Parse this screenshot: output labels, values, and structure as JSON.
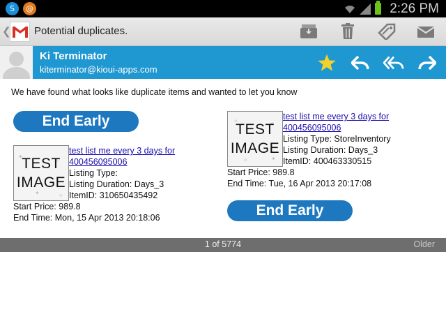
{
  "status_bar": {
    "time": "2:26 PM",
    "notification_icons": [
      "skype-icon",
      "app-notification-icon"
    ],
    "system_icons": [
      "wifi-icon",
      "signal-icon",
      "battery-icon"
    ],
    "battery_color": "#6ac21b"
  },
  "action_bar": {
    "title": "Potential duplicates.",
    "actions": [
      "archive-icon",
      "delete-icon",
      "label-icon",
      "mark-unread-icon"
    ]
  },
  "sender": {
    "name": "Ki Terminator",
    "email": "kiterminator@kioui-apps.com",
    "actions": [
      "star-icon",
      "reply-icon",
      "reply-all-icon",
      "forward-icon"
    ],
    "header_color": "#1f97d0",
    "star_color": "#f2d22a"
  },
  "message": {
    "intro": "We have found what looks like duplicate items and wanted to let you know",
    "button_label": "End Early",
    "button_color": "#1d78c0",
    "items": [
      {
        "thumb_line1": "TEST",
        "thumb_line2": "IMAGE",
        "title_line1": "test list me every 3 days for",
        "title_line2": "400456095006",
        "listing_type": "Listing Type:",
        "listing_duration": "Listing Duration: Days_3",
        "item_id": "ItemID: 310650435492",
        "start_price": "Start Price: 989.8",
        "end_time": "End Time: Mon, 15 Apr 2013 20:18:06"
      },
      {
        "thumb_line1": "TEST",
        "thumb_line2": "IMAGE",
        "title_line1": "test list me every 3 days for",
        "title_line2": "400456095006",
        "listing_type": "Listing Type: StoreInventory",
        "listing_duration": "Listing Duration: Days_3",
        "item_id": "ItemID: 400463330515",
        "start_price": "Start Price: 989.8",
        "end_time": "End Time: Tue, 16 Apr 2013 20:17:08"
      }
    ]
  },
  "pager": {
    "count": "1 of 5774",
    "older_label": "Older"
  }
}
